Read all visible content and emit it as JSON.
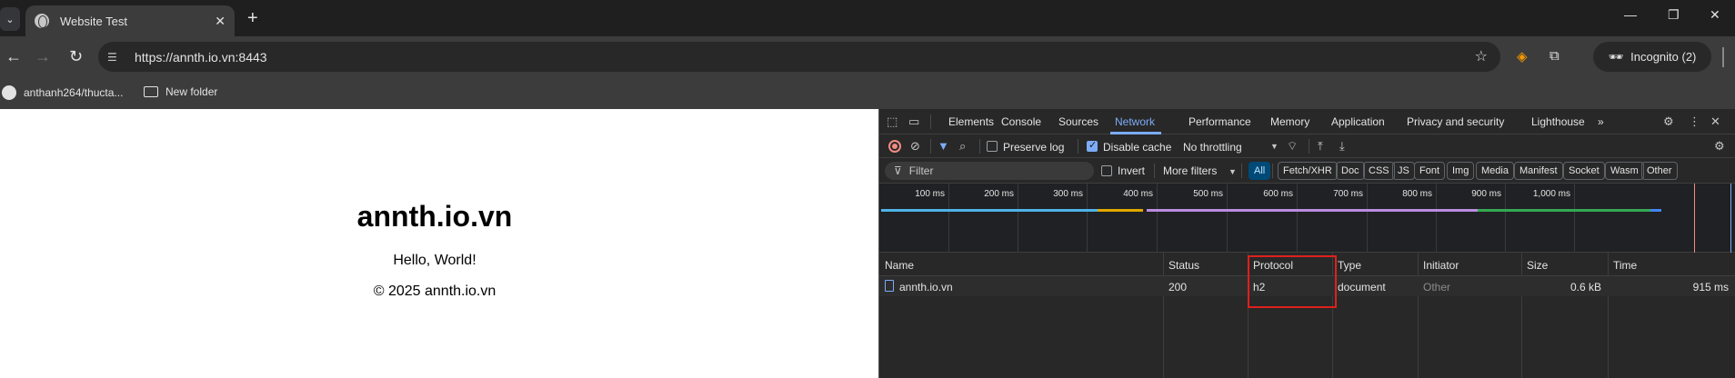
{
  "browser": {
    "tab": {
      "title": "Website Test",
      "close": "✕"
    },
    "new_tab": "+",
    "window_controls": {
      "minimize": "—",
      "restore": "❐",
      "close": "✕"
    },
    "nav": {
      "back": "←",
      "forward": "→",
      "reload": "↻"
    },
    "omnibox": {
      "url": "https://annth.io.vn:8443"
    },
    "incognito_label": "Incognito (2)",
    "bookmarks": [
      {
        "label": "anthanh264/thucta..."
      },
      {
        "label": "New folder"
      }
    ]
  },
  "page": {
    "heading": "annth.io.vn",
    "greeting": "Hello, World!",
    "footer": "© 2025 annth.io.vn"
  },
  "devtools": {
    "tabs": [
      "Elements",
      "Console",
      "Sources",
      "Network",
      "Performance",
      "Memory",
      "Application",
      "Privacy and security",
      "Lighthouse"
    ],
    "active_tab": "Network",
    "more_tabs": "»",
    "controls": {
      "preserve_log": "Preserve log",
      "preserve_log_checked": false,
      "disable_cache": "Disable cache",
      "disable_cache_checked": true,
      "throttling": "No throttling"
    },
    "filter": {
      "placeholder": "Filter",
      "invert": "Invert",
      "more_filters": "More filters",
      "types": [
        "All",
        "Fetch/XHR",
        "Doc",
        "CSS",
        "JS",
        "Font",
        "Img",
        "Media",
        "Manifest",
        "Socket",
        "Wasm",
        "Other"
      ],
      "active_type": "All"
    },
    "timeline_ticks": [
      "100 ms",
      "200 ms",
      "300 ms",
      "400 ms",
      "500 ms",
      "600 ms",
      "700 ms",
      "800 ms",
      "900 ms",
      "1,000 ms"
    ],
    "columns": [
      "Name",
      "Status",
      "Protocol",
      "Type",
      "Initiator",
      "Size",
      "Time"
    ],
    "rows": [
      {
        "name": "annth.io.vn",
        "status": "200",
        "protocol": "h2",
        "type": "document",
        "initiator": "Other",
        "size": "0.6 kB",
        "time": "915 ms"
      }
    ]
  }
}
